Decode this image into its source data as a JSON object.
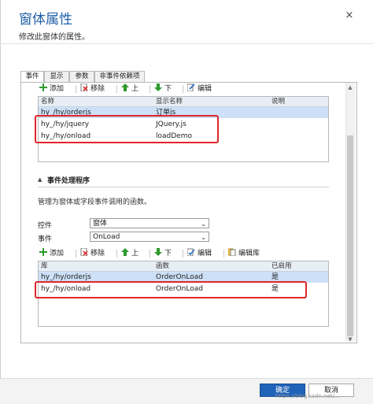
{
  "header": {
    "title": "窗体属性",
    "subtitle": "修改此窗体的属性。",
    "close_glyph": "×"
  },
  "tabs": [
    {
      "label": "事件",
      "active": true
    },
    {
      "label": "显示",
      "active": false
    },
    {
      "label": "参数",
      "active": false
    },
    {
      "label": "非事件依赖项",
      "active": false
    }
  ],
  "libs_section": {
    "toolbar": {
      "add": "添加",
      "remove": "移除",
      "up": "上",
      "down": "下",
      "edit": "编辑"
    },
    "columns": {
      "name": "名称",
      "display_name": "显示名称",
      "description": "说明"
    },
    "rows": [
      {
        "name": "hy_/hy/orderjs",
        "display_name": "订单js",
        "description": "",
        "selected": true
      },
      {
        "name": "hy_/hy/jquery",
        "display_name": "JQuery.js",
        "description": "",
        "selected": false
      },
      {
        "name": "hy_/hy/onload",
        "display_name": "loadDemo",
        "description": "",
        "selected": false
      }
    ]
  },
  "event_section": {
    "title": "事件处理程序",
    "description": "管理为窗体或字段事件调用的函数。",
    "control_label": "控件",
    "control_value": "窗体",
    "event_label": "事件",
    "event_value": "OnLoad",
    "toolbar": {
      "add": "添加",
      "remove": "移除",
      "up": "上",
      "down": "下",
      "edit": "编辑",
      "edit_library": "编辑库"
    },
    "columns": {
      "library": "库",
      "function": "函数",
      "enabled": "已启用"
    },
    "rows": [
      {
        "library": "hy_/hy/orderjs",
        "function": "OrderOnLoad",
        "enabled": "是",
        "selected": true
      },
      {
        "library": "hy_/hy/onload",
        "function": "OrderOnLoad",
        "enabled": "是",
        "selected": false
      }
    ]
  },
  "footer": {
    "ok": "确定",
    "cancel": "取消",
    "watermark": "https://blog.csdn.net/..."
  },
  "colors": {
    "title": "#1f5fa8",
    "selected_row": "#cde0f7",
    "highlight_box": "#e0262b",
    "primary_button": "#2063b8"
  }
}
